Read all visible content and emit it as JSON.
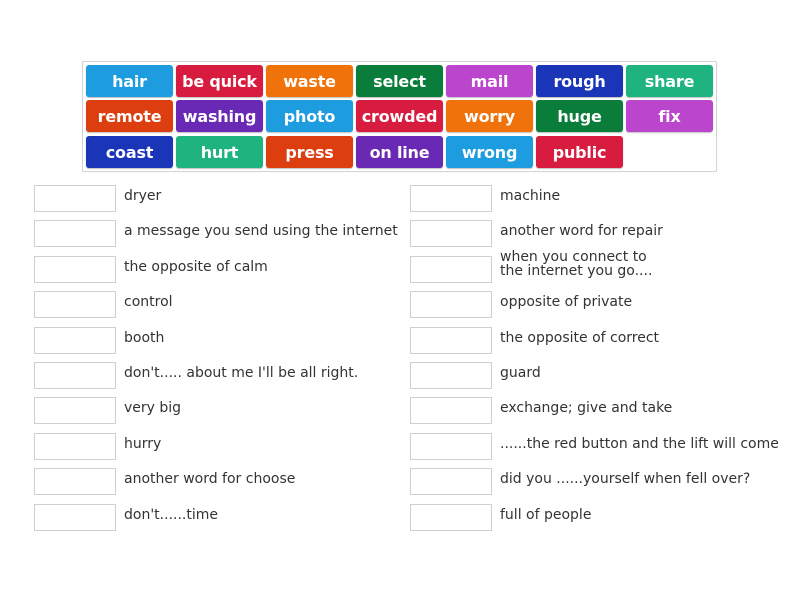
{
  "word_bank": [
    {
      "label": "hair",
      "color": "#1e9ce0"
    },
    {
      "label": "be quick",
      "color": "#d81c3f"
    },
    {
      "label": "waste",
      "color": "#f0720a"
    },
    {
      "label": "select",
      "color": "#0a7d3a"
    },
    {
      "label": "mail",
      "color": "#bb45cc"
    },
    {
      "label": "rough",
      "color": "#1a35b8"
    },
    {
      "label": "share",
      "color": "#1fb37f"
    },
    {
      "label": "remote",
      "color": "#dc3e10"
    },
    {
      "label": "washing",
      "color": "#6a29b4"
    },
    {
      "label": "photo",
      "color": "#1e9ce0"
    },
    {
      "label": "crowded",
      "color": "#d81c3f"
    },
    {
      "label": "worry",
      "color": "#f0720a"
    },
    {
      "label": "huge",
      "color": "#0a7d3a"
    },
    {
      "label": "fix",
      "color": "#bb45cc"
    },
    {
      "label": "coast",
      "color": "#1a35b8"
    },
    {
      "label": "hurt",
      "color": "#1fb37f"
    },
    {
      "label": "press",
      "color": "#dc3e10"
    },
    {
      "label": "on line",
      "color": "#6a29b4"
    },
    {
      "label": "wrong",
      "color": "#1e9ce0"
    },
    {
      "label": "public",
      "color": "#d81c3f"
    }
  ],
  "left_column": [
    {
      "prompt": "dryer",
      "answer": ""
    },
    {
      "prompt": "a message you send using the internet",
      "answer": ""
    },
    {
      "prompt": "the opposite of calm",
      "answer": ""
    },
    {
      "prompt": "control",
      "answer": ""
    },
    {
      "prompt": "booth",
      "answer": ""
    },
    {
      "prompt": "don't..... about me I'll be all right.",
      "answer": ""
    },
    {
      "prompt": "very big",
      "answer": ""
    },
    {
      "prompt": "hurry",
      "answer": ""
    },
    {
      "prompt": "another word for choose",
      "answer": ""
    },
    {
      "prompt": "don't......time",
      "answer": ""
    }
  ],
  "right_column": [
    {
      "prompt": "machine",
      "answer": ""
    },
    {
      "prompt": "another word for repair",
      "answer": ""
    },
    {
      "prompt": "when you connect to\nthe internet you go....",
      "answer": ""
    },
    {
      "prompt": "opposite of private",
      "answer": ""
    },
    {
      "prompt": "the opposite of correct",
      "answer": ""
    },
    {
      "prompt": "guard",
      "answer": ""
    },
    {
      "prompt": "exchange; give and take",
      "answer": ""
    },
    {
      "prompt": "......the red button and the lift will come",
      "answer": ""
    },
    {
      "prompt": "did you ......yourself when fell over?",
      "answer": ""
    },
    {
      "prompt": "full of people",
      "answer": ""
    }
  ]
}
